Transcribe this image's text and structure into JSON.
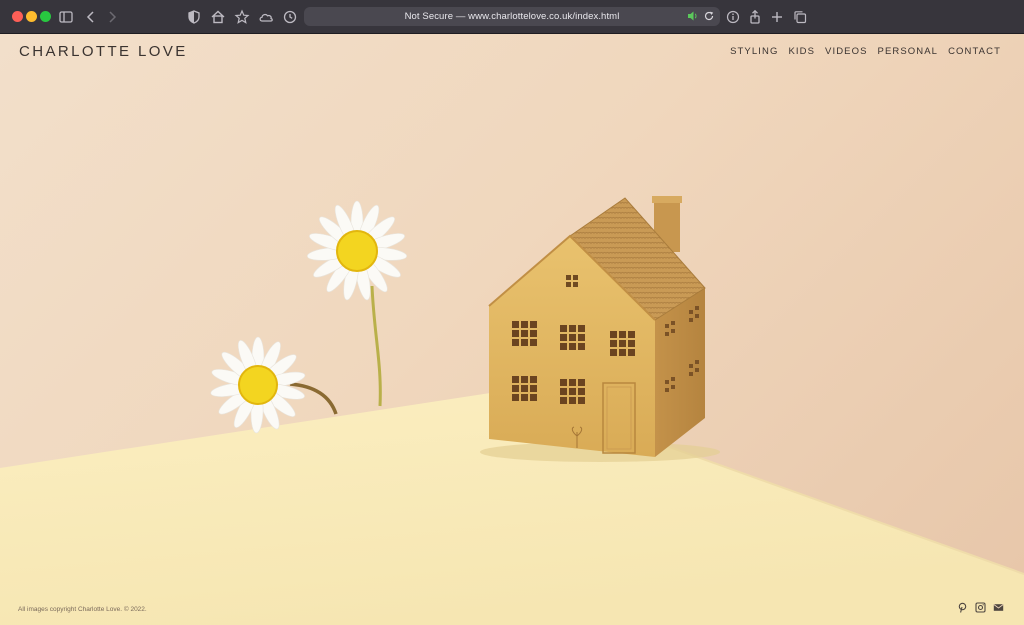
{
  "browser": {
    "address_text": "Not Secure — www.charlottelove.co.uk/index.html",
    "icons": [
      "sidebar-icon",
      "back-icon",
      "forward-icon",
      "shield-icon",
      "home-icon",
      "star-icon",
      "cloud-icon",
      "history-icon",
      "audio-icon",
      "reload-icon",
      "info-icon",
      "share-icon",
      "new-tab-icon",
      "tab-overview-icon"
    ]
  },
  "site": {
    "brand": "CHARLOTTE LOVE",
    "nav": [
      "STYLING",
      "KIDS",
      "VIDEOS",
      "PERSONAL",
      "CONTACT"
    ],
    "footer": "All images copyright Charlotte Love. © 2022.",
    "social_icons": [
      "pinterest-icon",
      "instagram-icon",
      "mail-icon"
    ]
  },
  "colors": {
    "chrome": "#37353c",
    "backdrop": "#f0d7bd",
    "table": "#fbeec0",
    "house_gold": "#e0b563"
  }
}
